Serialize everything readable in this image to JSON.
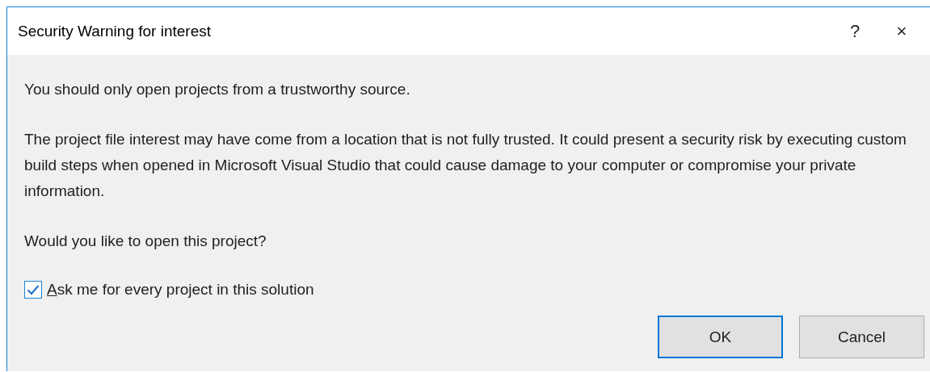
{
  "window": {
    "title": "Security Warning for interest",
    "help_button": "?",
    "close_button": "×"
  },
  "message": {
    "lead": "You should only open projects from a trustworthy source.",
    "detail": "The project file interest may have come from a location that is not fully trusted. It could present a security risk by executing custom build steps when opened in Microsoft Visual Studio that could cause damage to your computer or compromise your private information.",
    "question": "Would you like to open this project?"
  },
  "checkbox": {
    "label": "Ask me for every project in this solution",
    "checked": true,
    "first_letter_underlined": true
  },
  "buttons": [
    {
      "label": "OK",
      "default": true
    },
    {
      "label": "Cancel",
      "default": false
    }
  ]
}
